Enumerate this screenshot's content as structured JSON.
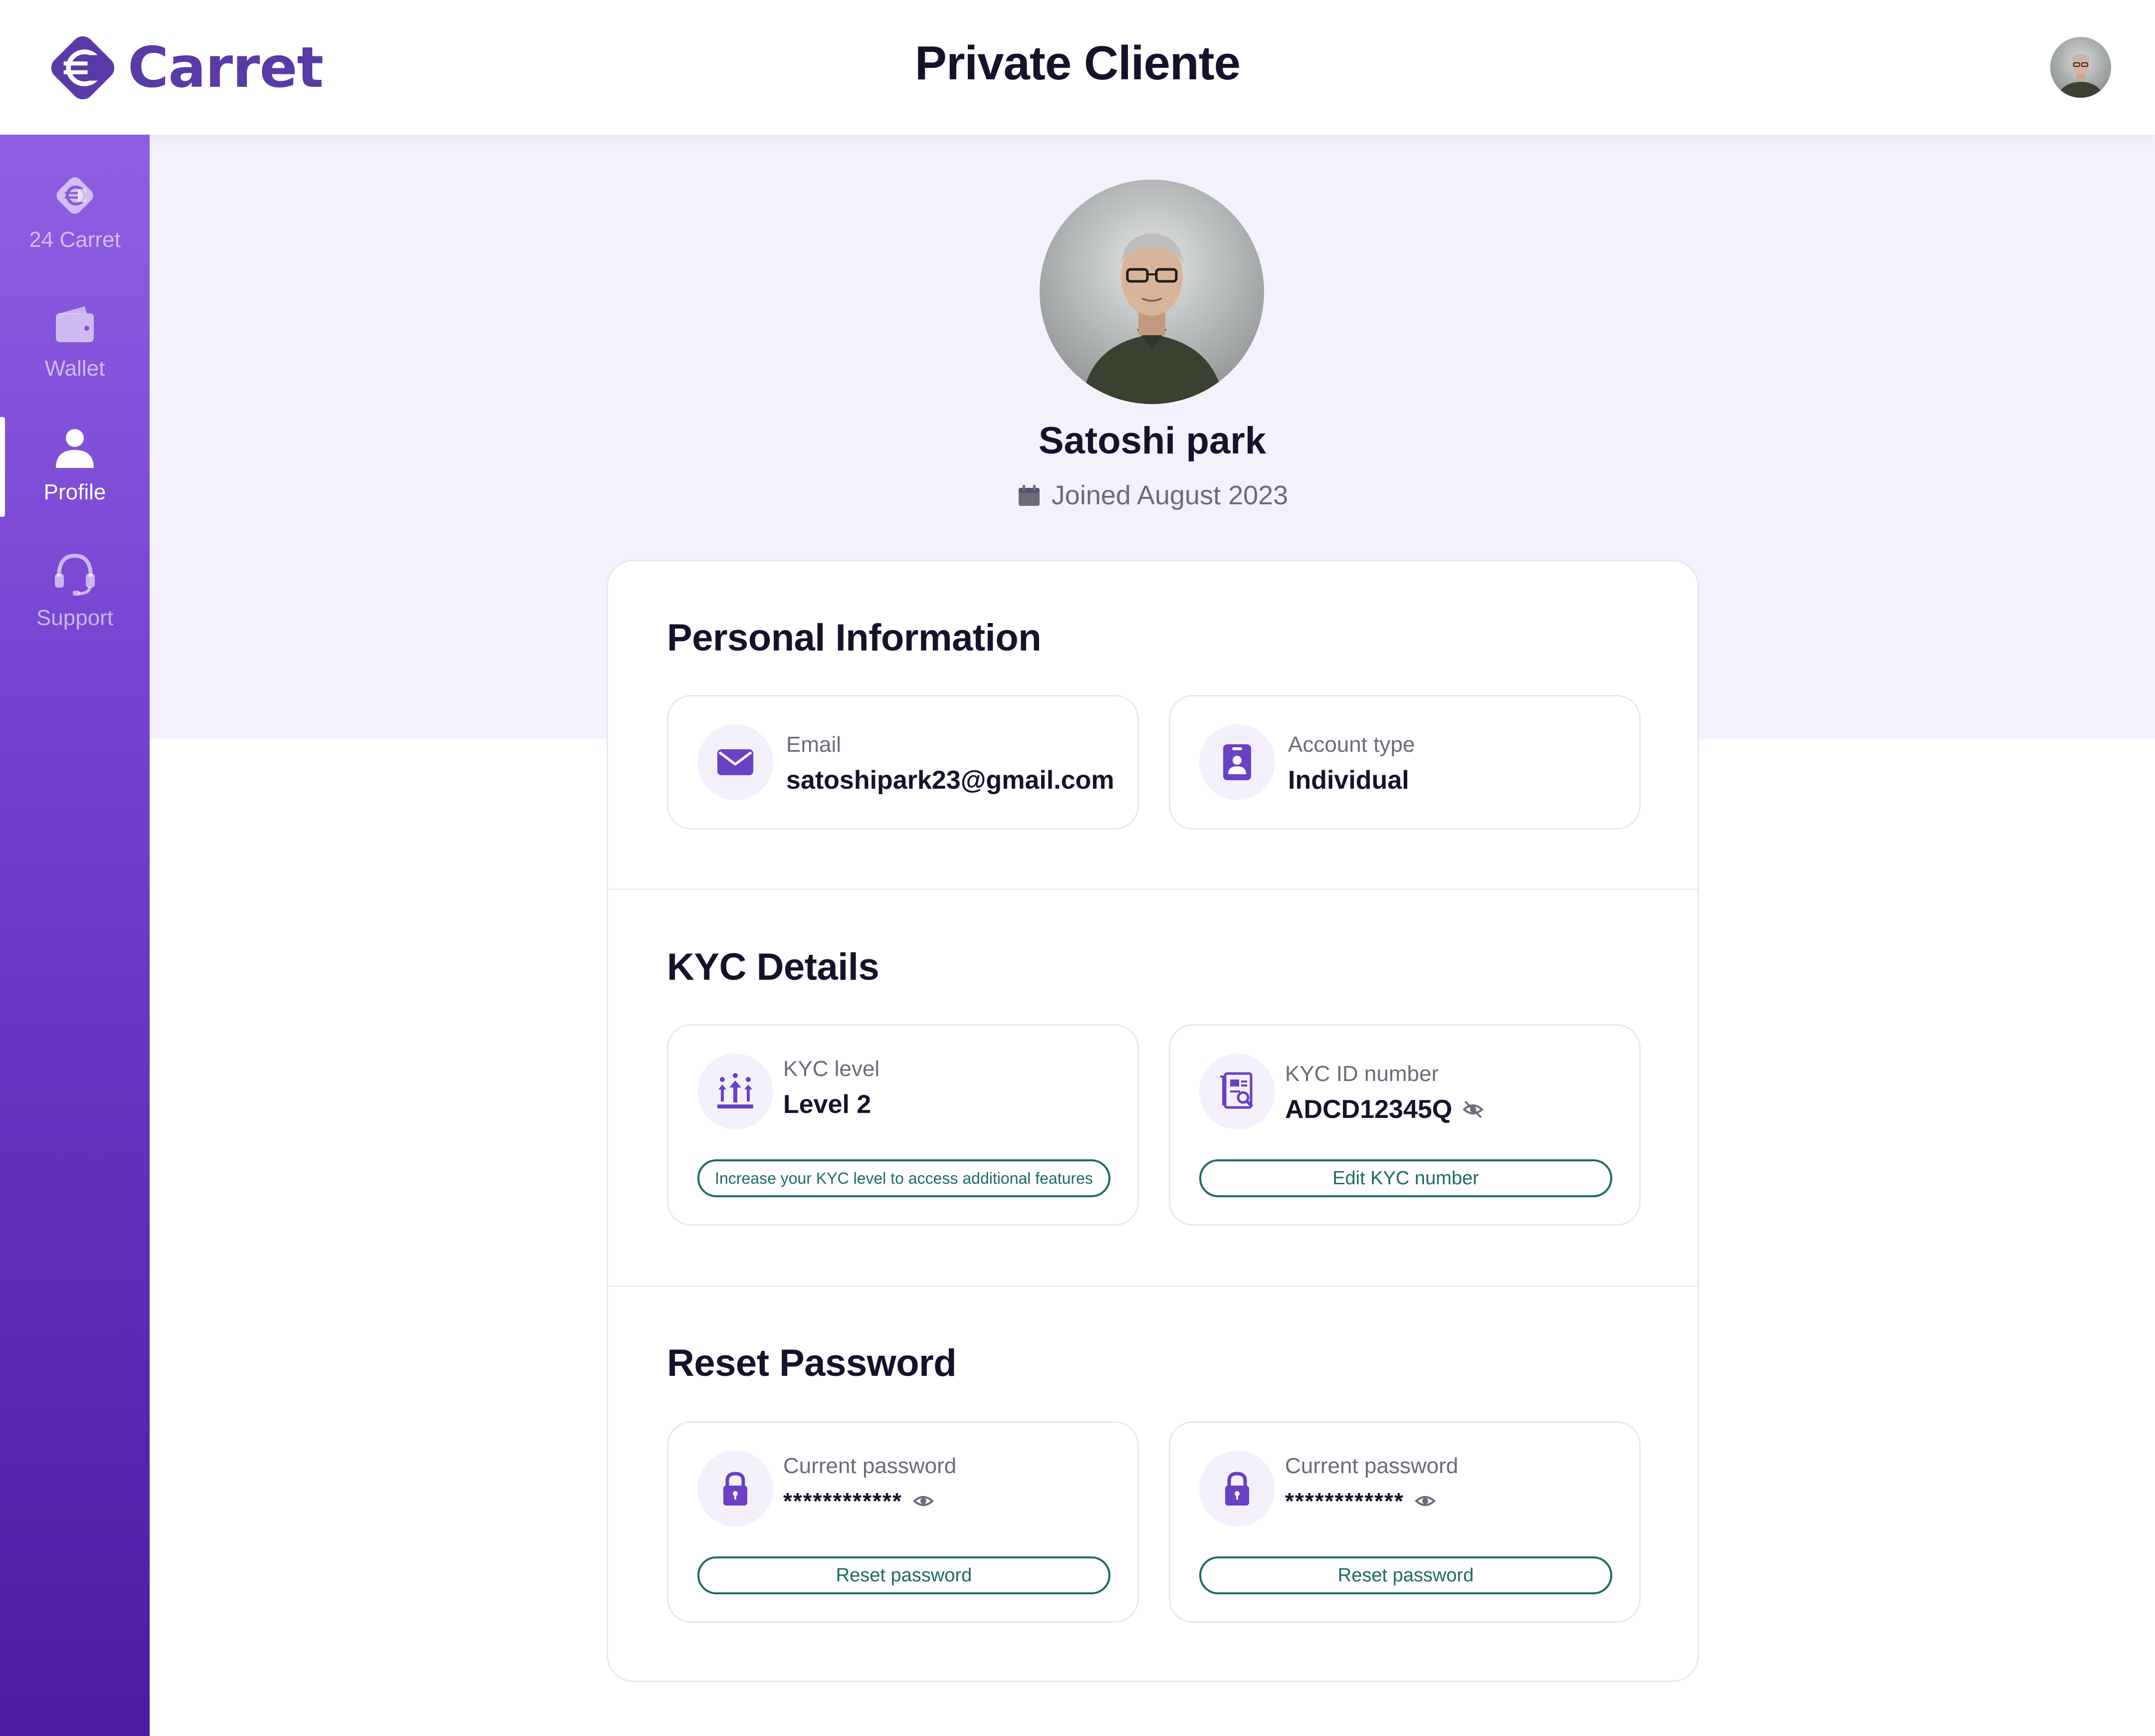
{
  "header": {
    "brand_name": "Carret",
    "page_title": "Private Cliente"
  },
  "sidebar": {
    "items": [
      {
        "label": "24 Carret",
        "icon": "carret-logo-icon"
      },
      {
        "label": "Wallet",
        "icon": "wallet-icon"
      },
      {
        "label": "Profile",
        "icon": "user-icon",
        "active": true
      },
      {
        "label": "Support",
        "icon": "headset-icon"
      }
    ]
  },
  "profile": {
    "name": "Satoshi park",
    "joined": "Joined August 2023"
  },
  "personal_info": {
    "title": "Personal Information",
    "email_label": "Email",
    "email_value": "satoshipark23@gmail.com",
    "account_label": "Account type",
    "account_value": "Individual"
  },
  "kyc": {
    "title": "KYC Details",
    "level_label": "KYC level",
    "level_value": "Level 2",
    "level_button": "Increase your KYC level to access additional features",
    "id_label": "KYC ID number",
    "id_value": "ADCD12345Q",
    "id_button": "Edit KYC number"
  },
  "reset_password": {
    "title": "Reset Password",
    "cards": [
      {
        "label": "Current password",
        "value": "************",
        "button": "Reset password"
      },
      {
        "label": "Current password",
        "value": "************",
        "button": "Reset password"
      }
    ]
  },
  "colors": {
    "brand_purple": "#5a3aa6",
    "accent_teal": "#1c6b66",
    "hero_bg": "#f4f1fd"
  }
}
